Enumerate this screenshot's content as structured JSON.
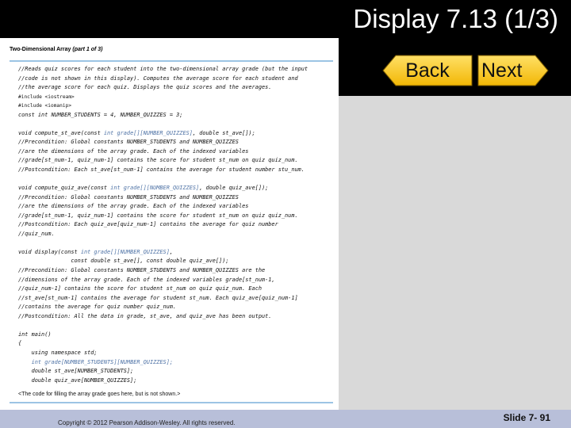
{
  "header": {
    "title": "Display 7.13 (1/3)"
  },
  "nav": {
    "back_label": "Back",
    "next_label": "Next"
  },
  "panel": {
    "title": "Two-Dimensional Array",
    "part": "(part 1 of 3)",
    "note": "<The code for filling the array grade goes here, but is not shown.>"
  },
  "code_lines": [
    "//Reads quiz scores for each student into the two-dimensional array grade (but the input",
    "//code is not shown in this display). Computes the average score for each student and",
    "//the average score for each quiz. Displays the quiz scores and the averages.",
    "#include <iostream>",
    "#include <iomanip>",
    "const int NUMBER_STUDENTS = 4, NUMBER_QUIZZES = 3;",
    "",
    "void compute_st_ave(const int grade[][NUMBER_QUIZZES], double st_ave[]);",
    "//Precondition: Global constants NUMBER_STUDENTS and NUMBER_QUIZZES",
    "//are the dimensions of the array grade. Each of the indexed variables",
    "//grade[st_num-1, quiz_num-1] contains the score for student st_num on quiz quiz_num.",
    "//Postcondition: Each st_ave[st_num-1] contains the average for student number stu_num.",
    "",
    "void compute_quiz_ave(const int grade[][NUMBER_QUIZZES], double quiz_ave[]);",
    "//Precondition: Global constants NUMBER_STUDENTS and NUMBER_QUIZZES",
    "//are the dimensions of the array grade. Each of the indexed variables",
    "//grade[st_num-1, quiz_num-1] contains the score for student st_num on quiz quiz_num.",
    "//Postcondition: Each quiz_ave[quiz_num-1] contains the average for quiz number",
    "//quiz_num.",
    "",
    "void display(const int grade[][NUMBER_QUIZZES],",
    "                const double st_ave[], const double quiz_ave[]);",
    "//Precondition: Global constants NUMBER_STUDENTS and NUMBER_QUIZZES are the",
    "//dimensions of the array grade. Each of the indexed variables grade[st_num-1,",
    "//quiz_num-1] contains the score for student st_num on quiz quiz_num. Each",
    "//st_ave[st_num-1] contains the average for student st_num. Each quiz_ave[quiz_num-1]",
    "//contains the average for quiz number quiz_num.",
    "//Postcondition: All the data in grade, st_ave, and quiz_ave has been output.",
    "",
    "int main()",
    "{",
    "    using namespace std;",
    "    int grade[NUMBER_STUDENTS][NUMBER_QUIZZES];",
    "    double st_ave[NUMBER_STUDENTS];",
    "    double quiz_ave[NUMBER_QUIZZES];"
  ],
  "footer": {
    "copyright": "Copyright © 2012 Pearson Addison-Wesley. All rights reserved.",
    "slide_number": "Slide 7- 91"
  },
  "colors": {
    "header_bg": "#000000",
    "title_text": "#ffffff",
    "nav_button_fill": "#ffd21f",
    "rule": "#9cc4e4",
    "code_highlight": "#4f73a6",
    "footer_bg": "#b8bfd9"
  },
  "icons": {
    "back": "left-arrow-icon",
    "next": "right-arrow-icon"
  }
}
